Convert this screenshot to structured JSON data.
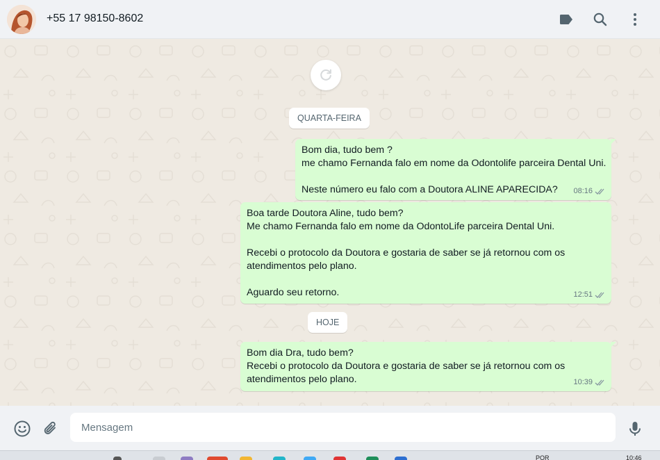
{
  "header": {
    "contact_name": "+55 17 98150-8602",
    "icons": [
      "label-icon",
      "search-icon",
      "menu-dots-icon"
    ]
  },
  "chat": {
    "refresh_icon": "refresh-icon",
    "day_chips": [
      "QUARTA-FEIRA",
      "HOJE"
    ],
    "messages": [
      {
        "lines": [
          "Bom dia, tudo bem ?",
          "me chamo Fernanda falo em nome da Odontolife parceira Dental Uni.",
          "",
          "Neste número eu falo com a Doutora ALINE APARECIDA?"
        ],
        "time": "08:16",
        "status": "read"
      },
      {
        "lines": [
          "Boa tarde Doutora Aline, tudo bem?",
          "Me chamo Fernanda falo em nome da OdontoLife parceira Dental Uni.",
          "",
          "Recebi o protocolo da Doutora e gostaria de saber se já retornou com os",
          "atendimentos pelo plano.",
          "",
          "Aguardo seu retorno."
        ],
        "time": "12:51",
        "status": "read"
      },
      {
        "lines": [
          "Bom dia Dra, tudo bem?",
          "Recebi o protocolo da Doutora e gostaria de saber se já retornou com os",
          "atendimentos pelo plano."
        ],
        "time": "10:39",
        "status": "read"
      }
    ]
  },
  "footer": {
    "placeholder": "Mensagem",
    "icons": [
      "emoji-icon",
      "attach-icon",
      "mic-icon"
    ]
  },
  "taskbar": {
    "lang": "POR",
    "clock": "10:46"
  },
  "colors": {
    "outgoing_bubble": "#d9fdd3",
    "chat_background": "#efeae2",
    "panel": "#f0f2f5",
    "read_ticks": "#8696a0"
  }
}
